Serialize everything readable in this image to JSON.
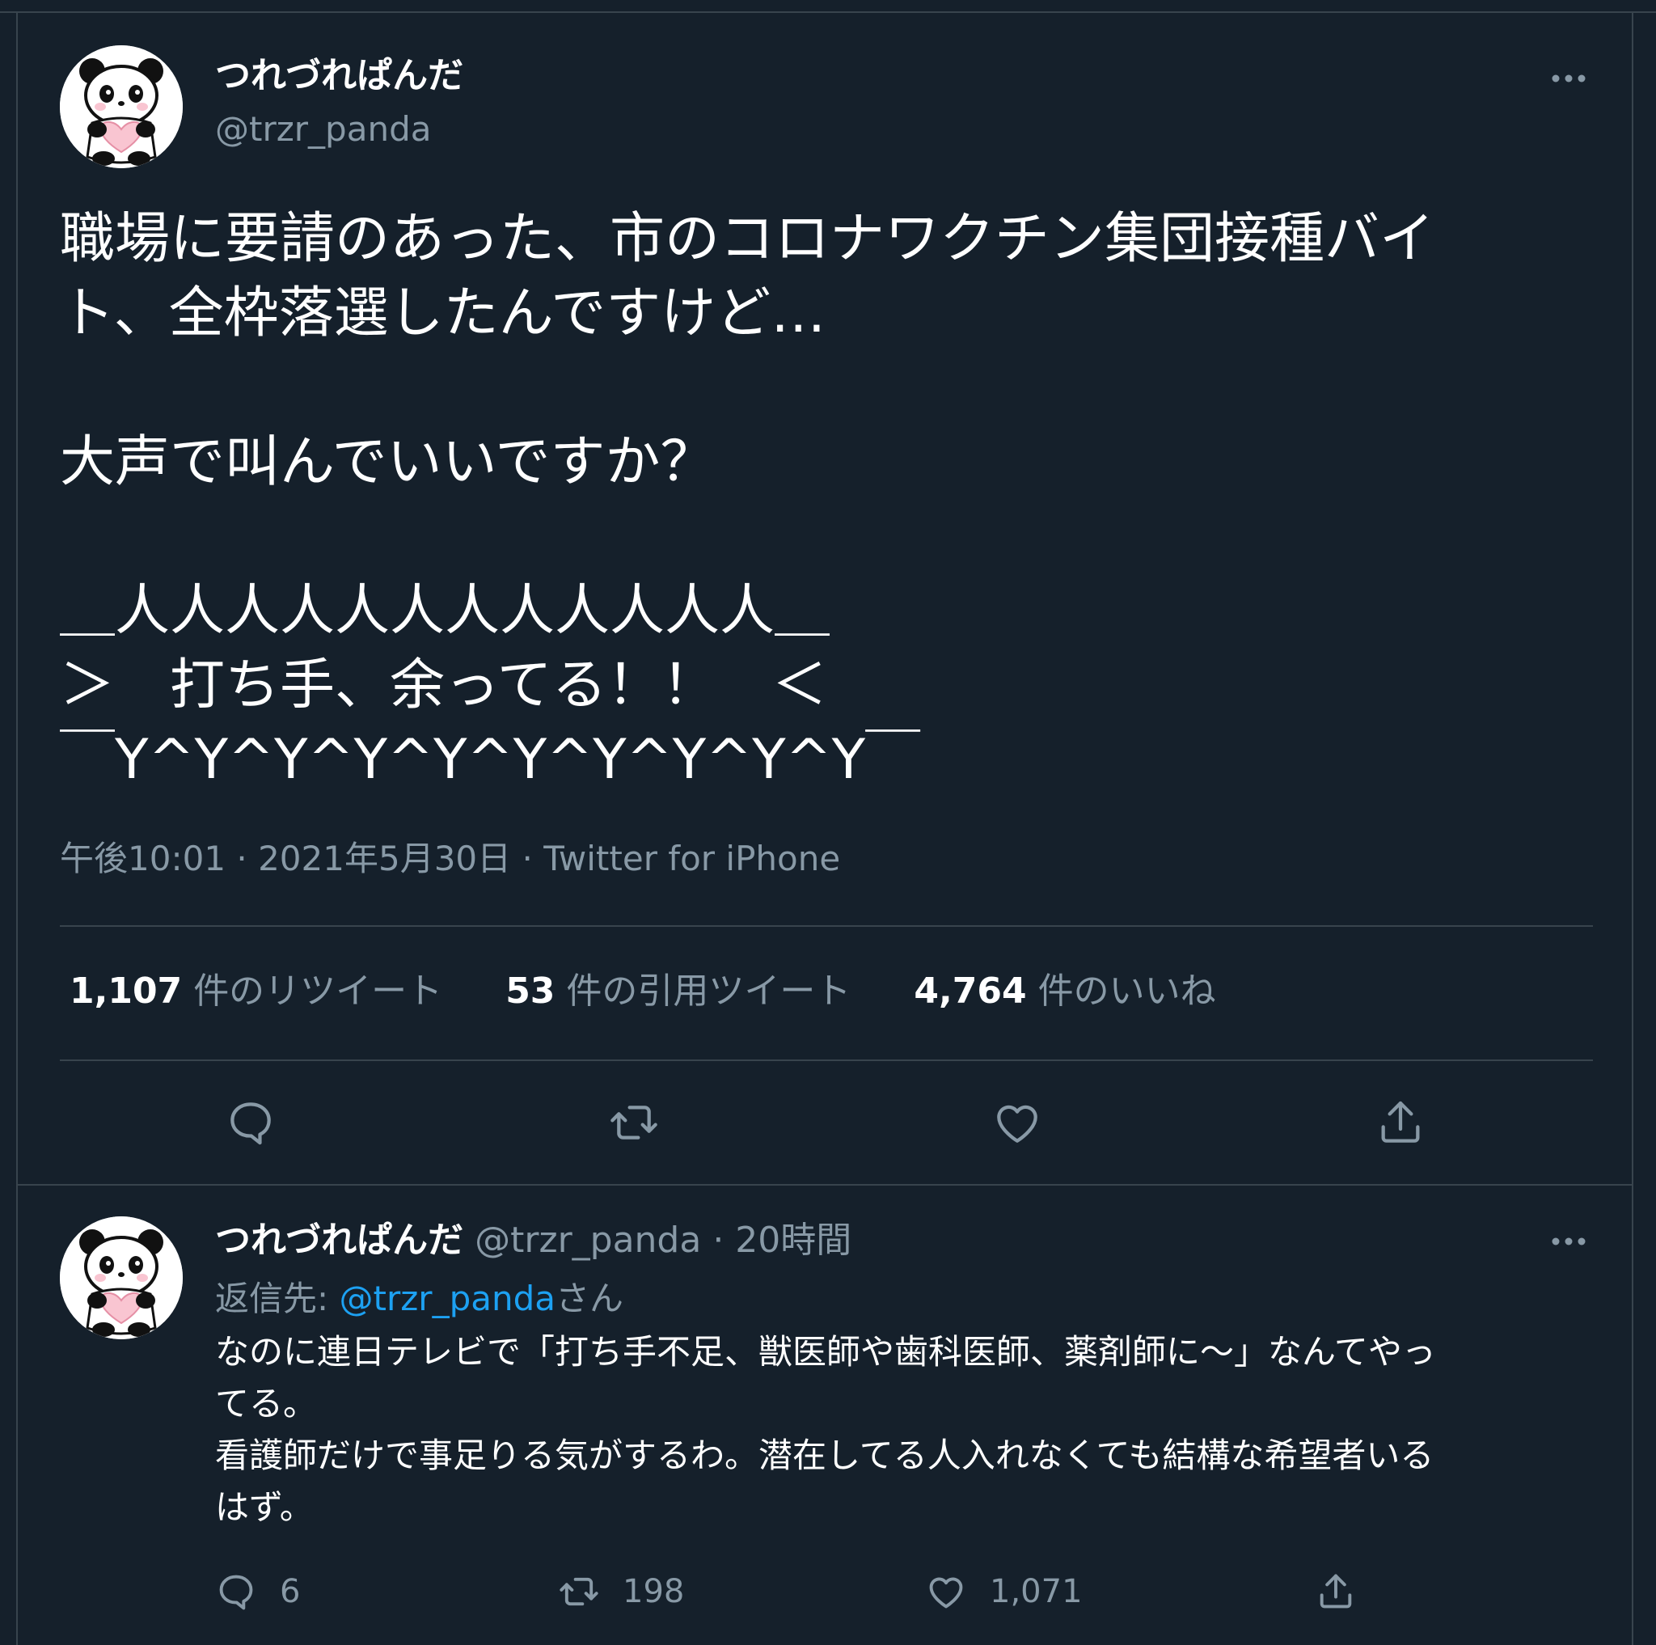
{
  "tweet": {
    "author_name": "つれづれぱんだ",
    "author_handle": "@trzr_panda",
    "text": "職場に要請のあった、市のコロナワクチン集団接種バイ\nト、全枠落選したんですけど…\n\n大声で叫んでいいですか？\n\n＿人人人人人人人人人人人人＿\n＞　打ち手、余ってる！！　＜\n￣Y^Y^Y^Y^Y^Y^Y^Y^Y^Y￣",
    "meta": "午後10:01 · 2021年5月30日 · Twitter for iPhone",
    "stats": {
      "retweets_count": "1,107",
      "retweets_label": "件のリツイート",
      "quotes_count": "53",
      "quotes_label": "件の引用ツイート",
      "likes_count": "4,764",
      "likes_label": "件のいいね"
    },
    "actions": [
      "reply-icon",
      "retweet-icon",
      "like-icon",
      "share-icon"
    ]
  },
  "reply": {
    "author_name": "つれづれぱんだ",
    "author_handle": "@trzr_panda",
    "time": "· 20時間",
    "reply_to_label": "返信先: ",
    "reply_to_handle": "@trzr_panda",
    "reply_to_suffix": "さん",
    "text": "なのに連日テレビで「打ち手不足、獣医師や歯科医師、薬剤師に～」なんてやっ\nてる。\n看護師だけで事足りる気がするわ。潜在してる人入れなくても結構な希望者いる\nはず。",
    "reply_count": "6",
    "retweet_count": "198",
    "like_count": "1,071"
  },
  "colors": {
    "background": "#15202b",
    "divider": "#38444d",
    "secondary_text": "#8899a6",
    "link": "#1da1f2",
    "avatar_pink": "#f9c5d1"
  }
}
